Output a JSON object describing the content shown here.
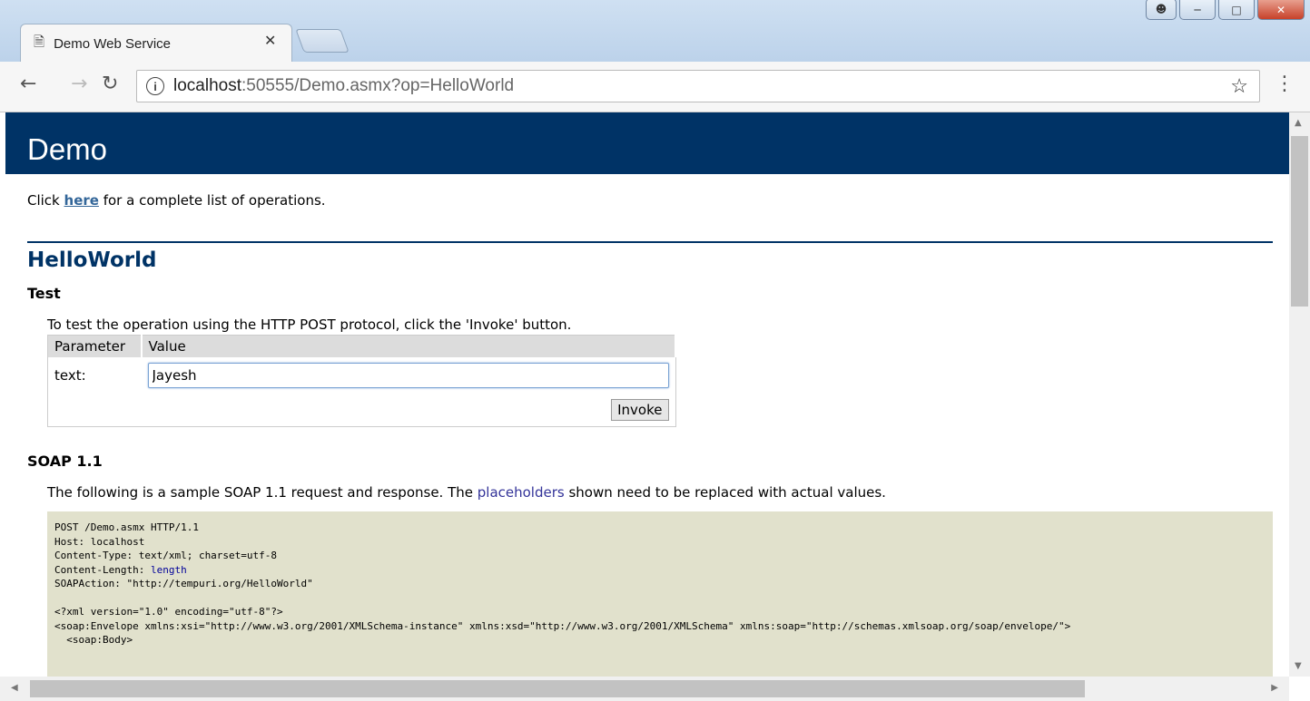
{
  "browser": {
    "tab_title": "Demo Web Service",
    "url_host": "localhost",
    "url_rest": ":50555/Demo.asmx?op=HelloWorld",
    "icons": {
      "tab": "page-icon",
      "back": "back-arrow-icon",
      "forward": "forward-arrow-icon",
      "reload": "reload-icon",
      "info": "info-icon",
      "bookmark": "star-icon",
      "menu": "kebab-menu-icon"
    }
  },
  "page": {
    "banner_title": "Demo",
    "intro": {
      "prefix": "Click ",
      "link": "here",
      "suffix": " for a complete list of operations."
    },
    "operation": "HelloWorld",
    "test": {
      "heading": "Test",
      "description": "To test the operation using the HTTP POST protocol, click the 'Invoke' button.",
      "columns": [
        "Parameter",
        "Value"
      ],
      "param_label": "text:",
      "param_value": "Jayesh",
      "invoke_label": "Invoke"
    },
    "soap11": {
      "heading": "SOAP 1.1",
      "desc_prefix": "The following is a sample SOAP 1.1 request and response. The ",
      "desc_placeholder": "placeholders",
      "desc_suffix": " shown need to be replaced with actual values.",
      "code_lines": [
        "POST /Demo.asmx HTTP/1.1",
        "Host: localhost",
        "Content-Type: text/xml; charset=utf-8",
        "Content-Length: ",
        "SOAPAction: \"http://tempuri.org/HelloWorld\"",
        "",
        "<?xml version=\"1.0\" encoding=\"utf-8\"?>",
        "<soap:Envelope xmlns:xsi=\"http://www.w3.org/2001/XMLSchema-instance\" xmlns:xsd=\"http://www.w3.org/2001/XMLSchema\" xmlns:soap=\"http://schemas.xmlsoap.org/soap/envelope/\">",
        "  <soap:Body>"
      ],
      "length_placeholder": "length"
    }
  },
  "colors": {
    "banner": "#003366",
    "code_bg": "#e1e1cc",
    "link": "#336699"
  }
}
